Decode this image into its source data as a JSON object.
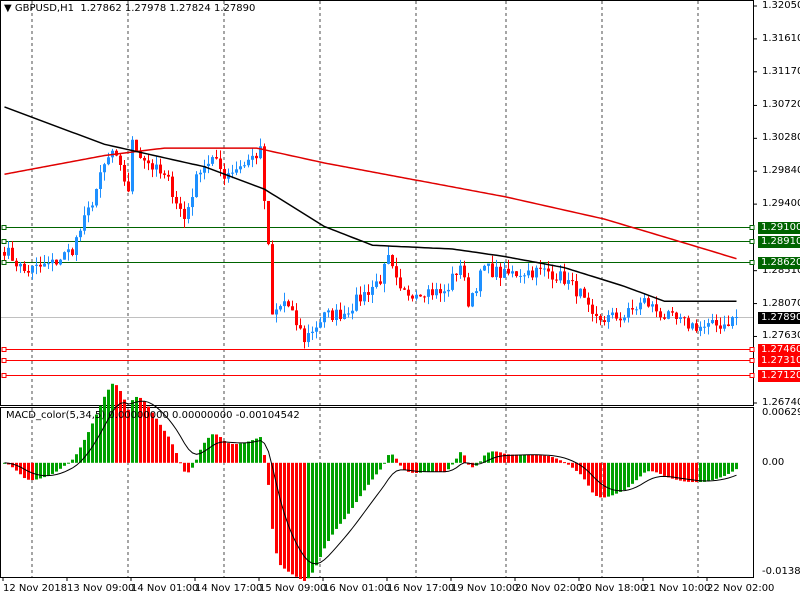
{
  "header": {
    "symbol": "GBPUSD,H1",
    "open": "1.27862",
    "high": "1.27978",
    "low": "1.27824",
    "close": "1.27890"
  },
  "indicator_header": {
    "name": "MACD_color(5,34,5)",
    "v1": "0.00000000",
    "v2": "0.00000000",
    "v3": "-0.00104542"
  },
  "chart_data": {
    "type": "candlestick",
    "title": "GBPUSD,H1",
    "ylim": [
      1.2674,
      1.3205
    ],
    "price_ticks": [
      "1.32050",
      "1.31610",
      "1.31170",
      "1.30720",
      "1.30280",
      "1.29840",
      "1.29400",
      "1.28510",
      "1.28070",
      "1.27630",
      "1.26740"
    ],
    "time_labels": [
      "12 Nov 2018",
      "13 Nov 09:00",
      "14 Nov 01:00",
      "14 Nov 17:00",
      "15 Nov 09:00",
      "16 Nov 01:00",
      "16 Nov 17:00",
      "19 Nov 10:00",
      "20 Nov 02:00",
      "20 Nov 18:00",
      "21 Nov 10:00",
      "22 Nov 02:00"
    ],
    "bar_count": 184,
    "close_anchors": [
      [
        0,
        1.288
      ],
      [
        5,
        1.285
      ],
      [
        12,
        1.286
      ],
      [
        17,
        1.288
      ],
      [
        21,
        1.293
      ],
      [
        25,
        1.299
      ],
      [
        27,
        1.301
      ],
      [
        31,
        1.296
      ],
      [
        32,
        1.302
      ],
      [
        37,
        1.299
      ],
      [
        41,
        1.297
      ],
      [
        45,
        1.292
      ],
      [
        49,
        1.299
      ],
      [
        52,
        1.3
      ],
      [
        55,
        1.298
      ],
      [
        60,
        1.2995
      ],
      [
        64,
        1.301
      ],
      [
        66,
        1.288
      ],
      [
        67,
        1.279
      ],
      [
        70,
        1.281
      ],
      [
        75,
        1.276
      ],
      [
        80,
        1.279
      ],
      [
        85,
        1.2795
      ],
      [
        90,
        1.282
      ],
      [
        94,
        1.284
      ],
      [
        96,
        1.2865
      ],
      [
        99,
        1.282
      ],
      [
        105,
        1.2825
      ],
      [
        110,
        1.282
      ],
      [
        114,
        1.286
      ],
      [
        116,
        1.281
      ],
      [
        120,
        1.2855
      ],
      [
        125,
        1.2845
      ],
      [
        130,
        1.285
      ],
      [
        136,
        1.285
      ],
      [
        140,
        1.284
      ],
      [
        144,
        1.282
      ],
      [
        147,
        1.2785
      ],
      [
        155,
        1.279
      ],
      [
        160,
        1.281
      ],
      [
        165,
        1.279
      ],
      [
        170,
        1.278
      ],
      [
        175,
        1.2775
      ],
      [
        180,
        1.278
      ],
      [
        183,
        1.2789
      ]
    ],
    "ma_black_anchors": [
      [
        0,
        1.307
      ],
      [
        25,
        1.302
      ],
      [
        50,
        1.299
      ],
      [
        65,
        1.296
      ],
      [
        80,
        1.291
      ],
      [
        92,
        1.2885
      ],
      [
        112,
        1.288
      ],
      [
        125,
        1.287
      ],
      [
        140,
        1.2855
      ],
      [
        155,
        1.283
      ],
      [
        165,
        1.281
      ],
      [
        183,
        1.281
      ]
    ],
    "ma_red_anchors": [
      [
        0,
        1.298
      ],
      [
        25,
        1.3005
      ],
      [
        40,
        1.3015
      ],
      [
        63,
        1.3015
      ],
      [
        80,
        1.2995
      ],
      [
        100,
        1.2975
      ],
      [
        125,
        1.295
      ],
      [
        150,
        1.292
      ],
      [
        175,
        1.288
      ],
      [
        183,
        1.2867
      ]
    ],
    "levels": [
      {
        "value": "1.29100",
        "color": "#006400"
      },
      {
        "value": "1.28910",
        "color": "#006400"
      },
      {
        "value": "1.28620",
        "color": "#006400"
      },
      {
        "value": "1.27460",
        "color": "#ff0000"
      },
      {
        "value": "1.27310",
        "color": "#ff0000"
      },
      {
        "value": "1.27120",
        "color": "#ff0000"
      }
    ],
    "current_price": "1.27890",
    "macd": {
      "ylim": [
        -0.013806,
        0.006298
      ],
      "ticks": [
        "0.006298",
        "0.00",
        "-0.013806"
      ]
    },
    "colors": {
      "bull": "#1e90ff",
      "bear": "#ff0000",
      "hist_up": "#00a000",
      "hist_down": "#ff0000"
    }
  }
}
